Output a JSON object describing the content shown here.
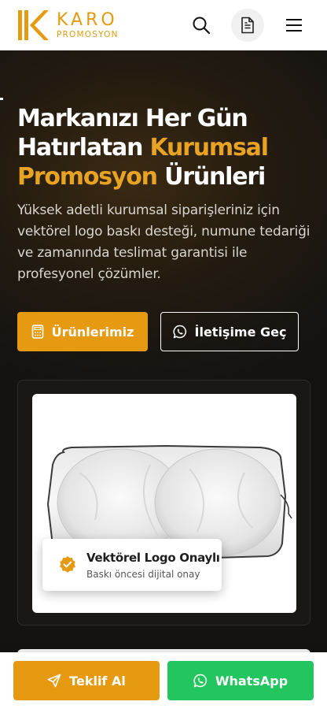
{
  "header": {
    "brand_line1": "KARO",
    "brand_line2": "PROMOSYON",
    "brand_color": "#e39b11",
    "icons": [
      "search-icon",
      "document-icon",
      "menu-icon"
    ]
  },
  "hero": {
    "title_part1": "Markanızı Her Gün Hatırlatan ",
    "title_accent": "Kurumsal Promosyon",
    "title_part2": " Ürünleri",
    "description": "Yüksek adetli kurumsal siparişleriniz için vektörel logo baskı desteği, numune tedariği ve zamanında teslimat garantisi ile profesyonel çözümler.",
    "primary_button": "Ürünlerimiz",
    "secondary_button": "İletişime Geç",
    "accent_color": "#e8a224"
  },
  "badge": {
    "title": "Vektörel Logo Onaylı",
    "subtitle": "Baskı öncesi dijital onay"
  },
  "bottom_bar": {
    "offer_label": "Teklif Al",
    "whatsapp_label": "WhatsApp",
    "offer_color": "#e69a12",
    "whatsapp_color": "#22c55e"
  }
}
